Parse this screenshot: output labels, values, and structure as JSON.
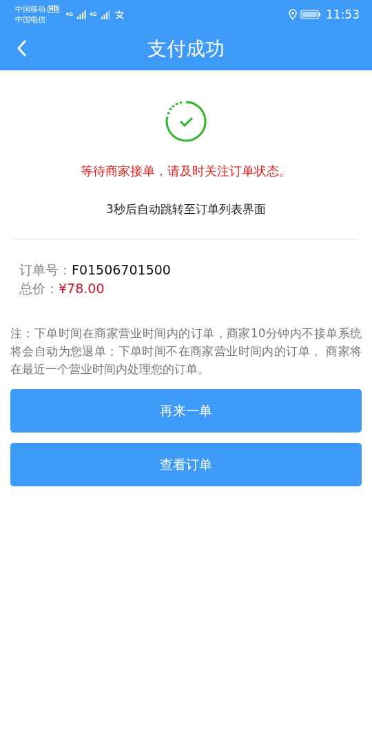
{
  "status_bar": {
    "carrier_1": "中国移动",
    "hd_badge": "HD",
    "carrier_2": "中国电信",
    "network_1": "4G",
    "network_2": "4G",
    "time": "11:53"
  },
  "header": {
    "title": "支付成功"
  },
  "message": "等待商家接单，请及时关注订单状态。",
  "redirect_note": "3秒后自动跳转至订单列表界面",
  "order": {
    "number_label": "订单号：",
    "number": "F01506701500",
    "price_label": "总价：",
    "price": "¥78.00"
  },
  "notice": "注：下单时间在商家营业时间内的订单，商家10分钟内不接单系统将会自动为您退单；下单时间不在商家营业时间内的订单， 商家将在最近一个营业时间内处理您的订单。",
  "buttons": [
    {
      "label": "再来一单"
    },
    {
      "label": "查看订单"
    }
  ]
}
